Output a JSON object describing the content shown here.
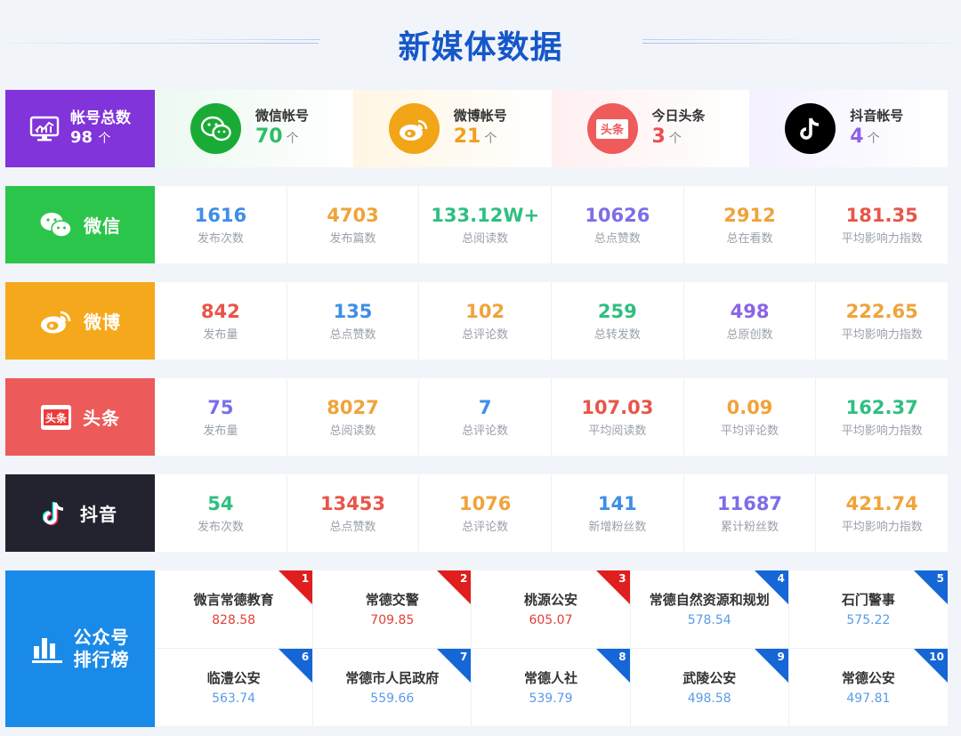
{
  "title": "新媒体数据",
  "accounts": {
    "total_label": "帐号总数",
    "total_count": "98",
    "unit": "个",
    "items": [
      {
        "name": "微信帐号",
        "count": "70",
        "color": "#2dbd6a",
        "bg": "#eefaf2",
        "badge_color": "#1aab37",
        "icon": "wechat-icon"
      },
      {
        "name": "微博帐号",
        "count": "21",
        "color": "#f0a020",
        "bg": "#fff8e8",
        "badge_color": "#f2a516",
        "icon": "weibo-icon"
      },
      {
        "name": "今日头条",
        "count": "3",
        "color": "#e84f4f",
        "bg": "#fff1f1",
        "badge_color": "#ef5a5a",
        "icon": "toutiao-icon"
      },
      {
        "name": "抖音帐号",
        "count": "4",
        "color": "#8b63e6",
        "bg": "#f5f1ff",
        "badge_color": "#000000",
        "icon": "douyin-icon"
      }
    ]
  },
  "wechat": {
    "label": "微信",
    "color": "#2cc54b",
    "stats": [
      {
        "value": "1616",
        "label": "发布次数",
        "color": "#3d8ee8"
      },
      {
        "value": "4703",
        "label": "发布篇数",
        "color": "#f0a33a"
      },
      {
        "value": "133.12W+",
        "label": "总阅读数",
        "color": "#2fbf80"
      },
      {
        "value": "10626",
        "label": "总点赞数",
        "color": "#7b6ee8"
      },
      {
        "value": "2912",
        "label": "总在看数",
        "color": "#f0a33a"
      },
      {
        "value": "181.35",
        "label": "平均影响力指数",
        "color": "#e8554a"
      }
    ]
  },
  "weibo": {
    "label": "微博",
    "color": "#f6a81c",
    "stats": [
      {
        "value": "842",
        "label": "发布量",
        "color": "#e8554a"
      },
      {
        "value": "135",
        "label": "总点赞数",
        "color": "#3d8ee8"
      },
      {
        "value": "102",
        "label": "总评论数",
        "color": "#f0a33a"
      },
      {
        "value": "259",
        "label": "总转发数",
        "color": "#2fbf80"
      },
      {
        "value": "498",
        "label": "总原创数",
        "color": "#8b63e6"
      },
      {
        "value": "222.65",
        "label": "平均影响力指数",
        "color": "#f0a33a"
      }
    ]
  },
  "toutiao": {
    "label": "头条",
    "color": "#ec5a5a",
    "stats": [
      {
        "value": "75",
        "label": "发布量",
        "color": "#7b6ee8"
      },
      {
        "value": "8027",
        "label": "总阅读数",
        "color": "#f0a33a"
      },
      {
        "value": "7",
        "label": "总评论数",
        "color": "#3d8ee8"
      },
      {
        "value": "107.03",
        "label": "平均阅读数",
        "color": "#e8554a"
      },
      {
        "value": "0.09",
        "label": "平均评论数",
        "color": "#f0a33a"
      },
      {
        "value": "162.37",
        "label": "平均影响力指数",
        "color": "#2fbf80"
      }
    ]
  },
  "douyin": {
    "label": "抖音",
    "color": "#23232f",
    "stats": [
      {
        "value": "54",
        "label": "发布次数",
        "color": "#2fbf80"
      },
      {
        "value": "13453",
        "label": "总点赞数",
        "color": "#e8554a"
      },
      {
        "value": "1076",
        "label": "总评论数",
        "color": "#f0a33a"
      },
      {
        "value": "141",
        "label": "新增粉丝数",
        "color": "#3d8ee8"
      },
      {
        "value": "11687",
        "label": "累计粉丝数",
        "color": "#7b6ee8"
      },
      {
        "value": "421.74",
        "label": "平均影响力指数",
        "color": "#f0a33a"
      }
    ]
  },
  "ranking": {
    "label_line1": "公众号",
    "label_line2": "排行榜",
    "items": [
      {
        "rank": "1",
        "name": "微言常德教育",
        "score": "828.58"
      },
      {
        "rank": "2",
        "name": "常德交警",
        "score": "709.85"
      },
      {
        "rank": "3",
        "name": "桃源公安",
        "score": "605.07"
      },
      {
        "rank": "4",
        "name": "常德自然资源和规划",
        "score": "578.54"
      },
      {
        "rank": "5",
        "name": "石门警事",
        "score": "575.22"
      },
      {
        "rank": "6",
        "name": "临澧公安",
        "score": "563.74"
      },
      {
        "rank": "7",
        "name": "常德市人民政府",
        "score": "559.66"
      },
      {
        "rank": "8",
        "name": "常德人社",
        "score": "539.79"
      },
      {
        "rank": "9",
        "name": "武陵公安",
        "score": "498.58"
      },
      {
        "rank": "10",
        "name": "常德公安",
        "score": "497.81"
      }
    ],
    "top_color": "#e01e1e",
    "top_score_color": "#e0413a",
    "other_color": "#1566d6",
    "other_score_color": "#5a9be8"
  }
}
